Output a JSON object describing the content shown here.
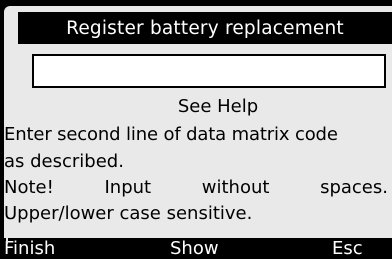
{
  "dialog": {
    "title": "Register battery replacement",
    "input": {
      "value": "",
      "placeholder": ""
    },
    "help_label": "See Help",
    "instructions": {
      "line1": "Enter second line of data matrix code",
      "line2": "as described.",
      "note_words": [
        "Note!",
        "Input",
        "without",
        "spaces."
      ],
      "line4": "Upper/lower case sensitive."
    }
  },
  "softkeys": {
    "finish": "Finish",
    "show": "Show",
    "esc": "Esc"
  }
}
